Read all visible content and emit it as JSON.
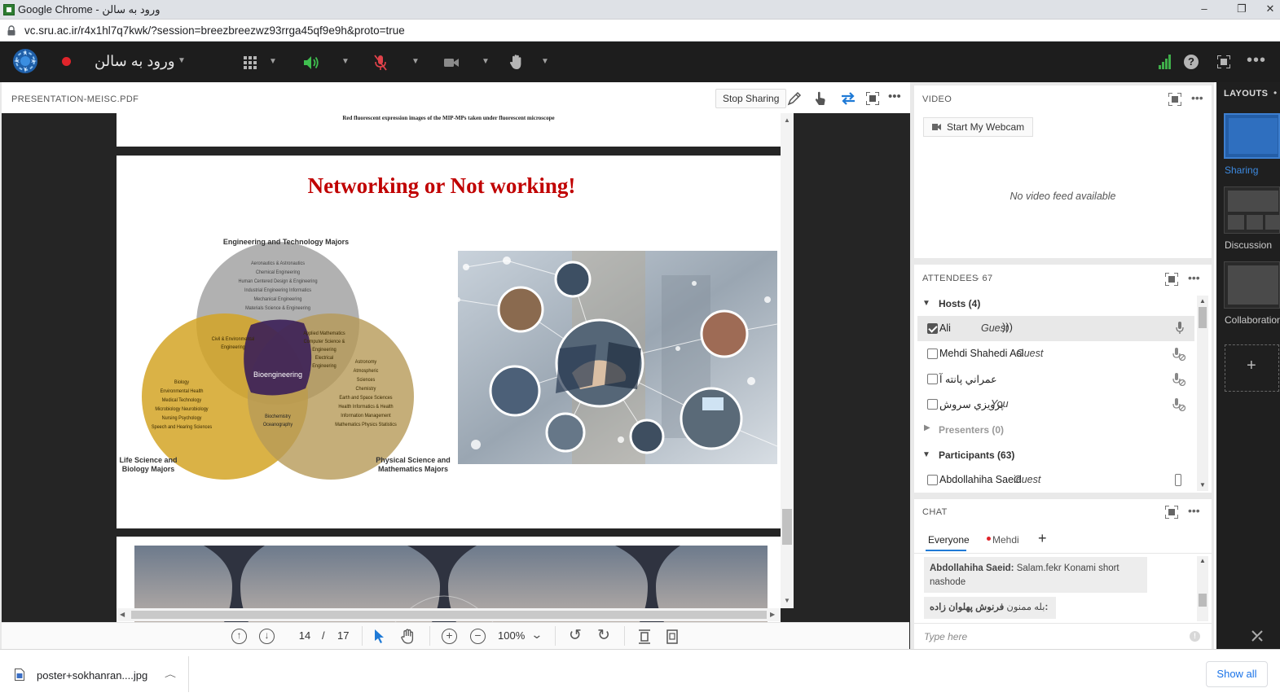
{
  "browser": {
    "title": "Google Chrome - ورود به سالن",
    "url": "vc.sru.ac.ir/r4x1hl7q7kwk/?session=breezbreezwz93rrga45qf9e9h&proto=true",
    "controls": {
      "minimize": "–",
      "restore": "❐",
      "close": "✕"
    }
  },
  "app": {
    "room_title": "ورود به سالن",
    "status_colors": {
      "recording": "#e0242b",
      "speaker": "#3fbf4f",
      "mic_muted": "#e0424a",
      "signal": "#3fae4a"
    }
  },
  "share_pod": {
    "file_name": "PRESENTATION-MEISC.PDF",
    "stop_sharing": "Stop Sharing"
  },
  "slide": {
    "prev_caption": "Red fluorescent expression images of the MIP-MPs taken under fluorescent microscope",
    "title": "Networking or Not working!",
    "title_color": "#c00000",
    "venn": {
      "top_label": "Engineering and Technology Majors",
      "left_label": "Life Science and Biology Majors",
      "right_label": "Physical Science and Mathematics Majors",
      "top_items": [
        "Aeronautics & Astronautics",
        "Chemical Engineering",
        "Human Centered Design & Engineering",
        "Industrial Engineering   Informatics",
        "Mechanical Engineering",
        "Materials Science & Engineering"
      ],
      "left_items": [
        "Biology",
        "Environmental Health",
        "Medical Technology",
        "Microbiology   Neurobiology",
        "Nursing   Psychology",
        "Speech and Hearing Sciences"
      ],
      "right_items": [
        "Astronomy",
        "Atmospheric",
        "Sciences",
        "Chemistry",
        "Earth and Space Sciences",
        "Health Informatics & Health",
        "Information Management",
        "Mathematics   Physics   Statistics"
      ],
      "top_left": [
        "Civil & Environmental",
        "Engineering"
      ],
      "top_right": [
        "Applied Mathematics",
        "Computer Science &",
        "Engineering",
        "Electrical",
        "Engineering"
      ],
      "left_right": [
        "Biochemistry",
        "Oceanography"
      ],
      "center": "Bioengineering"
    }
  },
  "pdf_toolbar": {
    "page_current": "14",
    "separator": "/",
    "page_total": "17",
    "zoom": "100%"
  },
  "video_pod": {
    "title": "VIDEO",
    "start_webcam": "Start My Webcam",
    "empty": "No video feed available"
  },
  "attendees_pod": {
    "title": "ATTENDEES",
    "count": "- 67",
    "hosts_label": "Hosts (4)",
    "hosts": [
      {
        "name": "Ali",
        "role": "Guest",
        "checked": true
      },
      {
        "name": "Mehdi Shahedi Asl",
        "role": "Guest",
        "checked": false
      },
      {
        "name": "عمراني پانته آ",
        "role": "",
        "checked": false
      },
      {
        "name": "پرويزي سروش",
        "role": "You",
        "checked": false
      }
    ],
    "presenters_label": "Presenters (0)",
    "participants_label": "Participants (63)",
    "participants": [
      {
        "name": "Abdollahiha Saeid",
        "role": "Guest",
        "checked": false
      }
    ]
  },
  "chat_pod": {
    "title": "CHAT",
    "tabs": [
      "Everyone",
      "Mehdi"
    ],
    "add": "+",
    "messages": [
      {
        "sender": "Abdollahiha Saeid:",
        "text": "Salam.fekr Konami short nashode"
      },
      {
        "sender": "فرنوش پهلوان زاده:",
        "text": "بله ممنون"
      }
    ],
    "placeholder": "Type here"
  },
  "layouts_pod": {
    "title": "LAYOUTS",
    "items": [
      "Sharing",
      "Discussion",
      "Collaboration"
    ],
    "add": "+"
  },
  "downloads": {
    "file": "poster+sokhanran....jpg",
    "show_all": "Show all"
  }
}
